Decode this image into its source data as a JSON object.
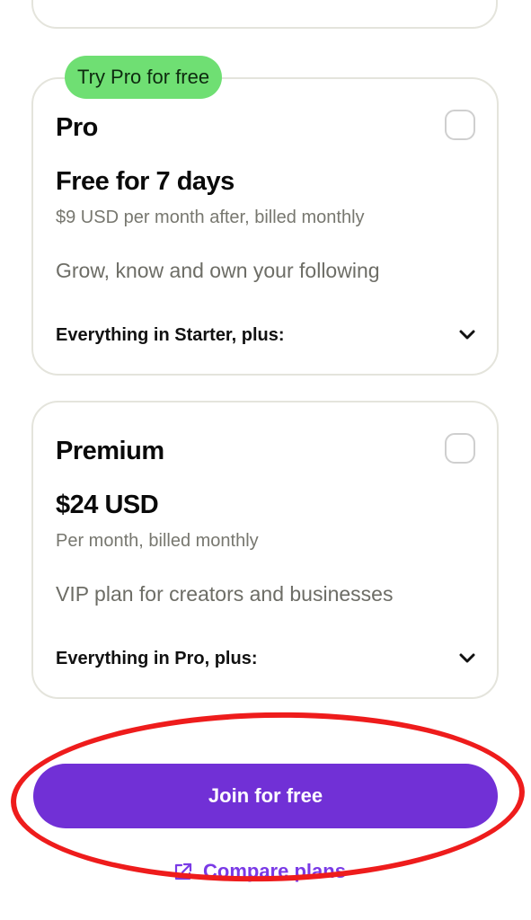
{
  "colors": {
    "accent": "#7130d6",
    "badge": "#6fdf73",
    "highlight_ring": "#ee1c1c",
    "card_border": "#e4e4dc",
    "muted_text": "#77776f"
  },
  "plans": [
    {
      "badge": "Try Pro for free",
      "name": "Pro",
      "price": "Free for 7 days",
      "billing": "$9 USD per month after, billed monthly",
      "description": "Grow, know and own your following",
      "features_label": "Everything in Starter, plus:",
      "checked": false
    },
    {
      "badge": "",
      "name": "Premium",
      "price": "$24 USD",
      "billing": "Per month, billed monthly",
      "description": "VIP plan for creators and businesses",
      "features_label": "Everything in Pro, plus:",
      "checked": false
    }
  ],
  "actions": {
    "join_label": "Join for free",
    "compare_label": "Compare plans"
  },
  "icons": {
    "expand": "chevron-down-icon",
    "external": "external-link-icon"
  }
}
